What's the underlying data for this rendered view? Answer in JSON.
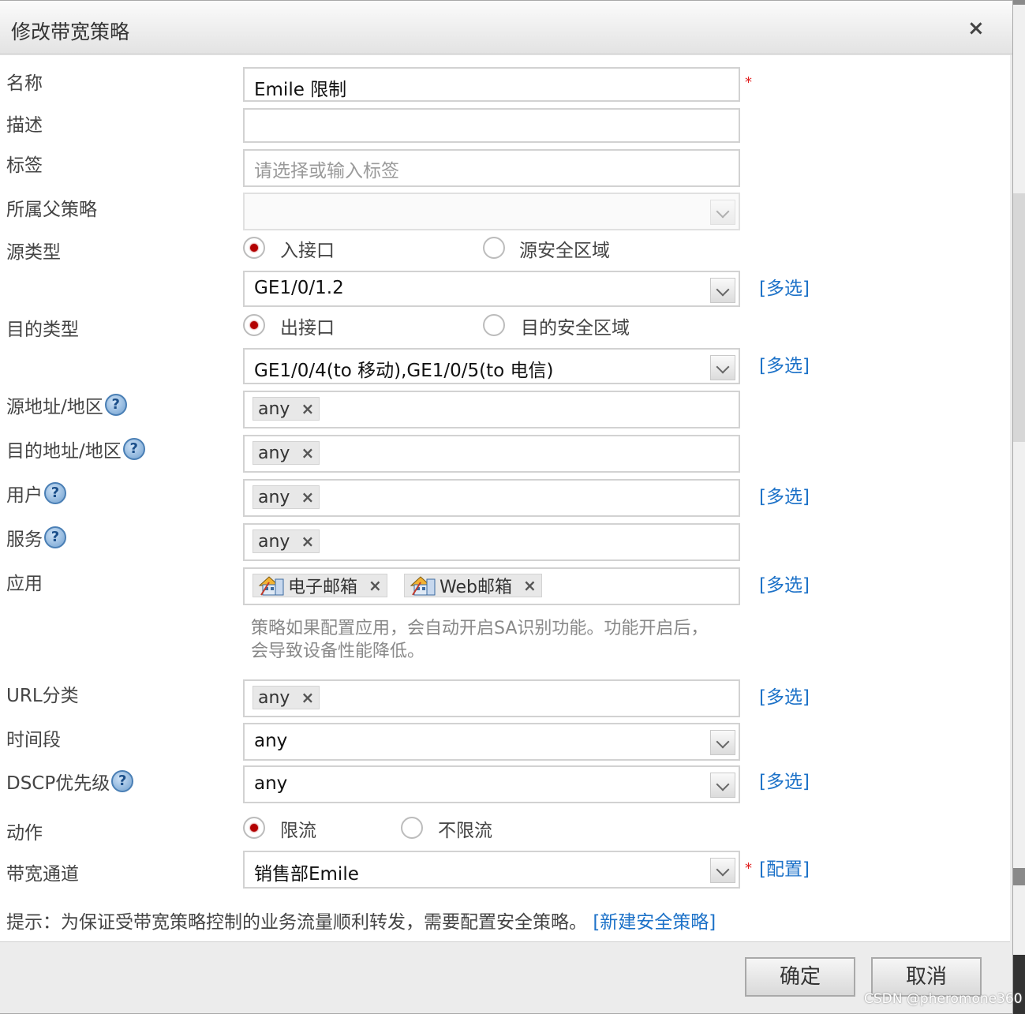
{
  "dialog": {
    "title": "修改带宽策略",
    "close_symbol": "×"
  },
  "form": {
    "name": {
      "label": "名称",
      "value": "Emile 限制",
      "required_mark": "*"
    },
    "description": {
      "label": "描述",
      "value": ""
    },
    "tags": {
      "label": "标签",
      "placeholder": "请选择或输入标签"
    },
    "parent_policy": {
      "label": "所属父策略",
      "value": ""
    },
    "source_type": {
      "label": "源类型",
      "options": [
        {
          "label": "入接口",
          "selected": true
        },
        {
          "label": "源安全区域",
          "selected": false
        }
      ],
      "value": "GE1/0/1.2",
      "multi_link": "[多选]"
    },
    "dest_type": {
      "label": "目的类型",
      "options": [
        {
          "label": "出接口",
          "selected": true
        },
        {
          "label": "目的安全区域",
          "selected": false
        }
      ],
      "value": "GE1/0/4(to 移动),GE1/0/5(to 电信)",
      "multi_link": "[多选]"
    },
    "source_address": {
      "label": "源地址/地区",
      "tag": "any"
    },
    "dest_address": {
      "label": "目的地址/地区",
      "tag": "any"
    },
    "user": {
      "label": "用户",
      "tag": "any",
      "multi_link": "[多选]"
    },
    "service": {
      "label": "服务",
      "tag": "any"
    },
    "application": {
      "label": "应用",
      "tags": [
        "电子邮箱",
        "Web邮箱"
      ],
      "multi_link": "[多选]",
      "note": "策略如果配置应用，会自动开启SA识别功能。功能开启后，会导致设备性能降低。"
    },
    "url_category": {
      "label": "URL分类",
      "tag": "any",
      "multi_link": "[多选]"
    },
    "time_range": {
      "label": "时间段",
      "value": "any"
    },
    "dscp": {
      "label": "DSCP优先级",
      "value": "any",
      "multi_link": "[多选]"
    },
    "action": {
      "label": "动作",
      "options": [
        {
          "label": "限流",
          "selected": true
        },
        {
          "label": "不限流",
          "selected": false
        }
      ]
    },
    "bandwidth_channel": {
      "label": "带宽通道",
      "value": "销售部Emile",
      "required_mark": "*",
      "config_link": "[配置]"
    },
    "help_symbol": "?",
    "tag_remove_symbol": "×"
  },
  "tip": {
    "text": "提示：为保证受带宽策略控制的业务流量顺利转发，需要配置安全策略。",
    "link": "[新建安全策略]"
  },
  "buttons": {
    "ok": "确定",
    "cancel": "取消"
  },
  "watermark": "CSDN @pheromone360",
  "colors": {
    "link": "#1d72c8",
    "radio_selected": "#b30000",
    "required": "#e02020"
  }
}
